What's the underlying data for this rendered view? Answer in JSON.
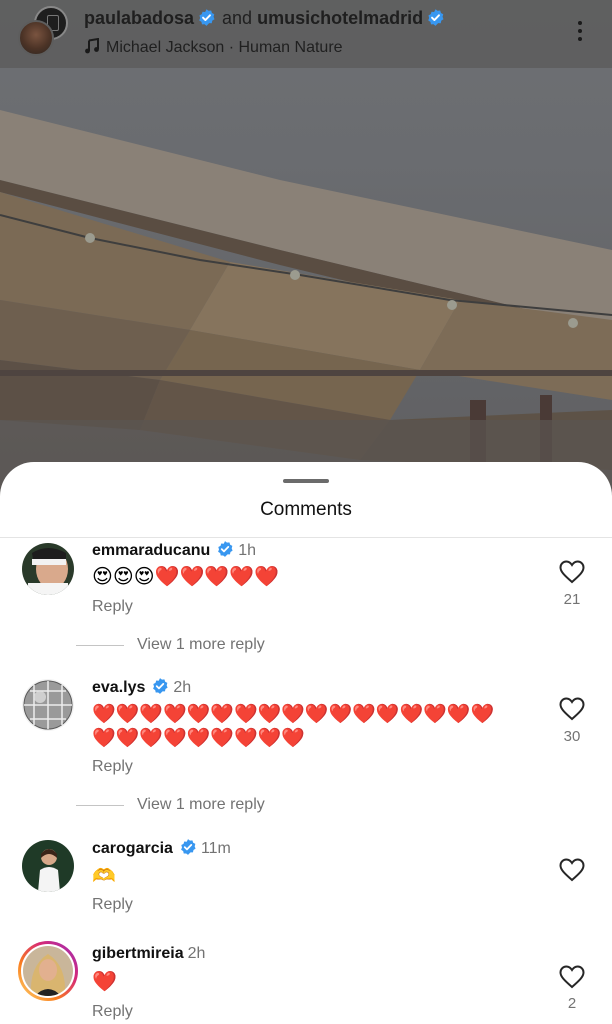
{
  "post_header": {
    "user1": "paulabadosa",
    "connector": "and",
    "user2": "umusichotelmadrid",
    "music_track": "Michael Jackson · Human Nature"
  },
  "sheet": {
    "title": "Comments"
  },
  "comments": [
    {
      "username": "emmaraducanu",
      "verified": true,
      "time": "1h",
      "text": "😍😍😍❤️❤️❤️❤️❤️",
      "reply_label": "Reply",
      "likes": "21",
      "more_replies": "View 1 more reply"
    },
    {
      "username": "eva.lys",
      "verified": true,
      "time": "2h",
      "text_line1": "❤️❤️❤️❤️❤️❤️❤️❤️❤️❤️❤️❤️❤️❤️❤️❤️❤️",
      "text_line2": "❤️❤️❤️❤️❤️❤️❤️❤️❤️",
      "reply_label": "Reply",
      "likes": "30",
      "more_replies": "View 1 more reply"
    },
    {
      "username": "carogarcia",
      "verified": true,
      "time": "11m",
      "text": "🫶",
      "reply_label": "Reply",
      "likes": ""
    },
    {
      "username": "gibertmireia",
      "verified": false,
      "time": "2h",
      "text": "❤️",
      "reply_label": "Reply",
      "likes": "2"
    }
  ],
  "colors": {
    "verified_blue": "#3897f0",
    "heart_red": "#e0242f",
    "muted_text": "#737373",
    "story_ring": "#d62976"
  },
  "icons": [
    "music-note-icon",
    "more-options-icon",
    "verified-badge-icon",
    "heart-outline-icon"
  ]
}
